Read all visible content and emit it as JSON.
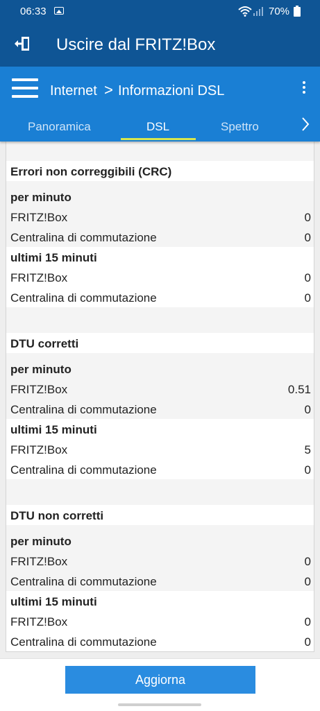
{
  "status_bar": {
    "time": "06:33",
    "battery": "70%"
  },
  "logout_bar": {
    "title": "Uscire dal FRITZ!Box"
  },
  "app_bar": {
    "breadcrumb": [
      "Internet",
      ">",
      "Informazioni DSL"
    ],
    "tabs": [
      {
        "label": "Panoramica",
        "active": false
      },
      {
        "label": "DSL",
        "active": true
      },
      {
        "label": "Spettro",
        "active": false
      }
    ]
  },
  "sections": [
    {
      "title": "Errori non correggibili (CRC)",
      "groups": [
        {
          "label": "per minuto",
          "rows": [
            {
              "label": "FRITZ!Box",
              "value": "0"
            },
            {
              "label": "Centralina di commutazione",
              "value": "0"
            }
          ]
        },
        {
          "label": "ultimi 15 minuti",
          "rows": [
            {
              "label": "FRITZ!Box",
              "value": "0"
            },
            {
              "label": "Centralina di commutazione",
              "value": "0"
            }
          ]
        }
      ]
    },
    {
      "title": "DTU corretti",
      "groups": [
        {
          "label": "per minuto",
          "rows": [
            {
              "label": "FRITZ!Box",
              "value": "0.51"
            },
            {
              "label": "Centralina di commutazione",
              "value": "0"
            }
          ]
        },
        {
          "label": "ultimi 15 minuti",
          "rows": [
            {
              "label": "FRITZ!Box",
              "value": "5"
            },
            {
              "label": "Centralina di commutazione",
              "value": "0"
            }
          ]
        }
      ]
    },
    {
      "title": "DTU non corretti",
      "groups": [
        {
          "label": "per minuto",
          "rows": [
            {
              "label": "FRITZ!Box",
              "value": "0"
            },
            {
              "label": "Centralina di commutazione",
              "value": "0"
            }
          ]
        },
        {
          "label": "ultimi 15 minuti",
          "rows": [
            {
              "label": "FRITZ!Box",
              "value": "0"
            },
            {
              "label": "Centralina di commutazione",
              "value": "0"
            }
          ]
        }
      ]
    }
  ],
  "footer": {
    "refresh_label": "Aggiorna"
  },
  "colors": {
    "header": "#0f5595",
    "appbar": "#1a7fd4",
    "tab_indicator": "#d6e64f",
    "button": "#2a8ce0"
  },
  "icons": [
    "image-icon",
    "wifi-icon",
    "signal-icon",
    "battery-icon",
    "exit-icon",
    "menu-icon",
    "more-icon",
    "chevron-right-icon"
  ]
}
